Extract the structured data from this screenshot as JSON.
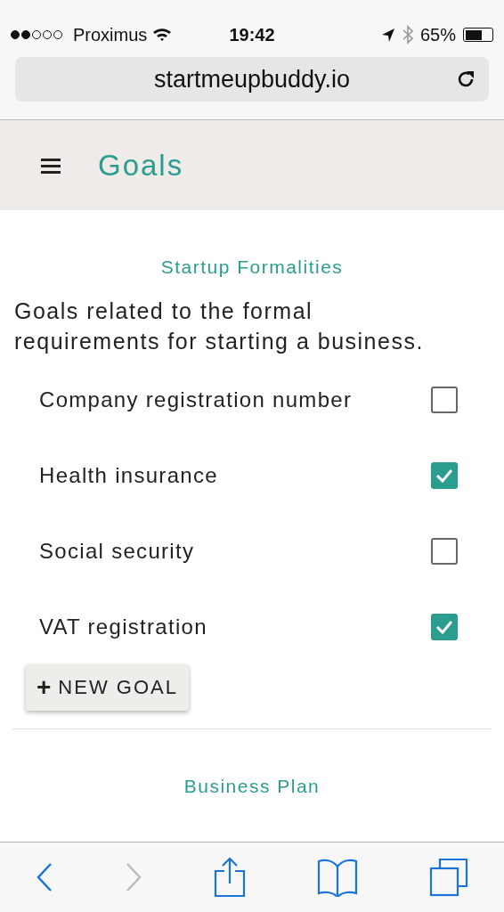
{
  "status_bar": {
    "carrier": "Proximus",
    "time": "19:42",
    "battery": "65%"
  },
  "address_bar": {
    "url": "startmeupbuddy.io"
  },
  "header": {
    "title": "Goals"
  },
  "sections": [
    {
      "title": "Startup Formalities",
      "description": "Goals related to the formal requirements for starting a business.",
      "goals": [
        {
          "label": "Company registration number",
          "checked": false
        },
        {
          "label": "Health insurance",
          "checked": true
        },
        {
          "label": "Social security",
          "checked": false
        },
        {
          "label": "VAT registration",
          "checked": true
        }
      ],
      "new_goal_button": {
        "icon": "+",
        "label": "NEW GOAL"
      }
    },
    {
      "title": "Business Plan"
    }
  ],
  "toolbar": {
    "back_disabled": false,
    "forward_disabled": true
  }
}
